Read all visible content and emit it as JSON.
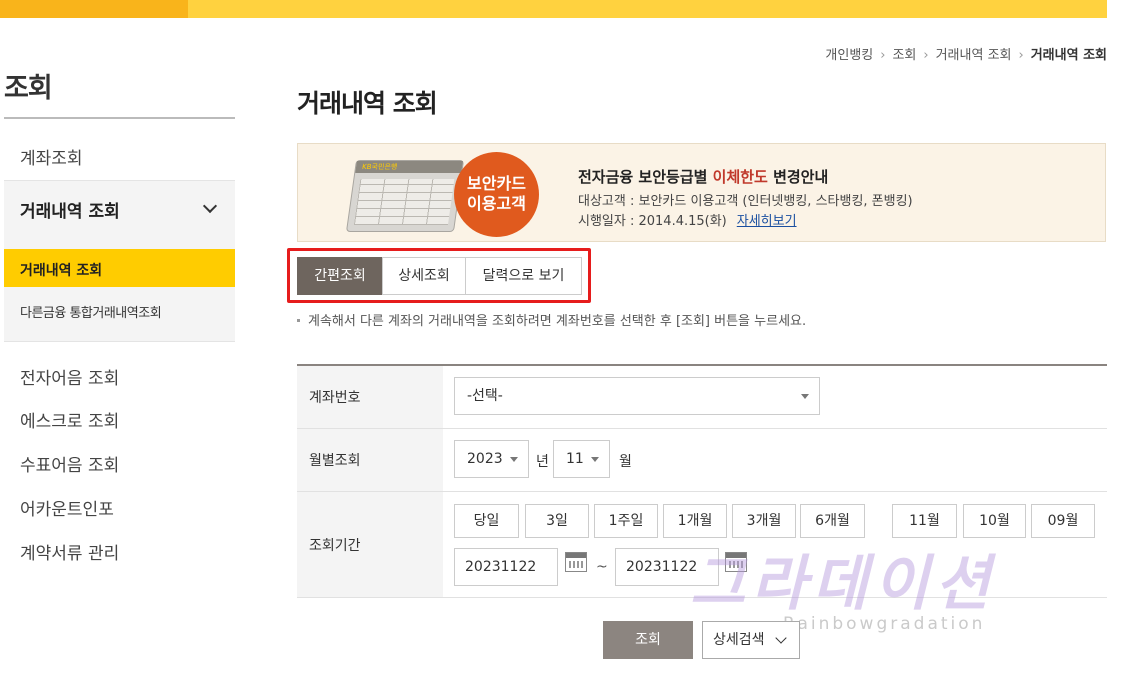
{
  "sidebar": {
    "title": "조회",
    "items": {
      "account": "계좌조회",
      "group_head": "거래내역 조회",
      "sub_active": "거래내역 조회",
      "sub_other": "다른금융 통합거래내역조회",
      "ebill": "전자어음 조회",
      "escrow": "에스크로 조회",
      "promissory": "수표어음 조회",
      "account_info": "어카운트인포",
      "contract_docs": "계약서류 관리"
    }
  },
  "breadcrumb": [
    "개인뱅킹",
    "조회",
    "거래내역 조회",
    "거래내역 조회"
  ],
  "page_title": "거래내역 조회",
  "banner": {
    "card_label": "KB국민은행",
    "badge_line1": "보안카드",
    "badge_line2": "이용고객",
    "title_pre": "전자금융 보안등급별 ",
    "title_hl": "이체한도",
    "title_post": " 변경안내",
    "target": "대상고객 : 보안카드 이용고객 (인터넷뱅킹, 스타뱅킹, 폰뱅킹)",
    "date": "시행일자 : 2014.4.15(화)",
    "link": "자세히보기"
  },
  "tabs": [
    "간편조회",
    "상세조회",
    "달력으로 보기"
  ],
  "notice": "계속해서 다른 계좌의 거래내역을 조회하려면 계좌번호를 선택한 후 [조회] 버튼을 누르세요.",
  "form": {
    "account_label": "계좌번호",
    "account_value": "-선택-",
    "month_label": "월별조회",
    "year_value": "2023",
    "year_unit": "년",
    "month_value": "11",
    "month_unit": "월",
    "period_label": "조회기간",
    "period_buttons": [
      "당일",
      "3일",
      "1주일",
      "1개월",
      "3개월",
      "6개월"
    ],
    "month_buttons": [
      "11월",
      "10월",
      "09월"
    ],
    "start_date": "20231122",
    "tilde": "~",
    "end_date": "20231122"
  },
  "actions": {
    "search": "조회",
    "detail": "상세검색"
  },
  "watermark": {
    "main": "그라데이션",
    "sub": "Rainbowgradation"
  }
}
